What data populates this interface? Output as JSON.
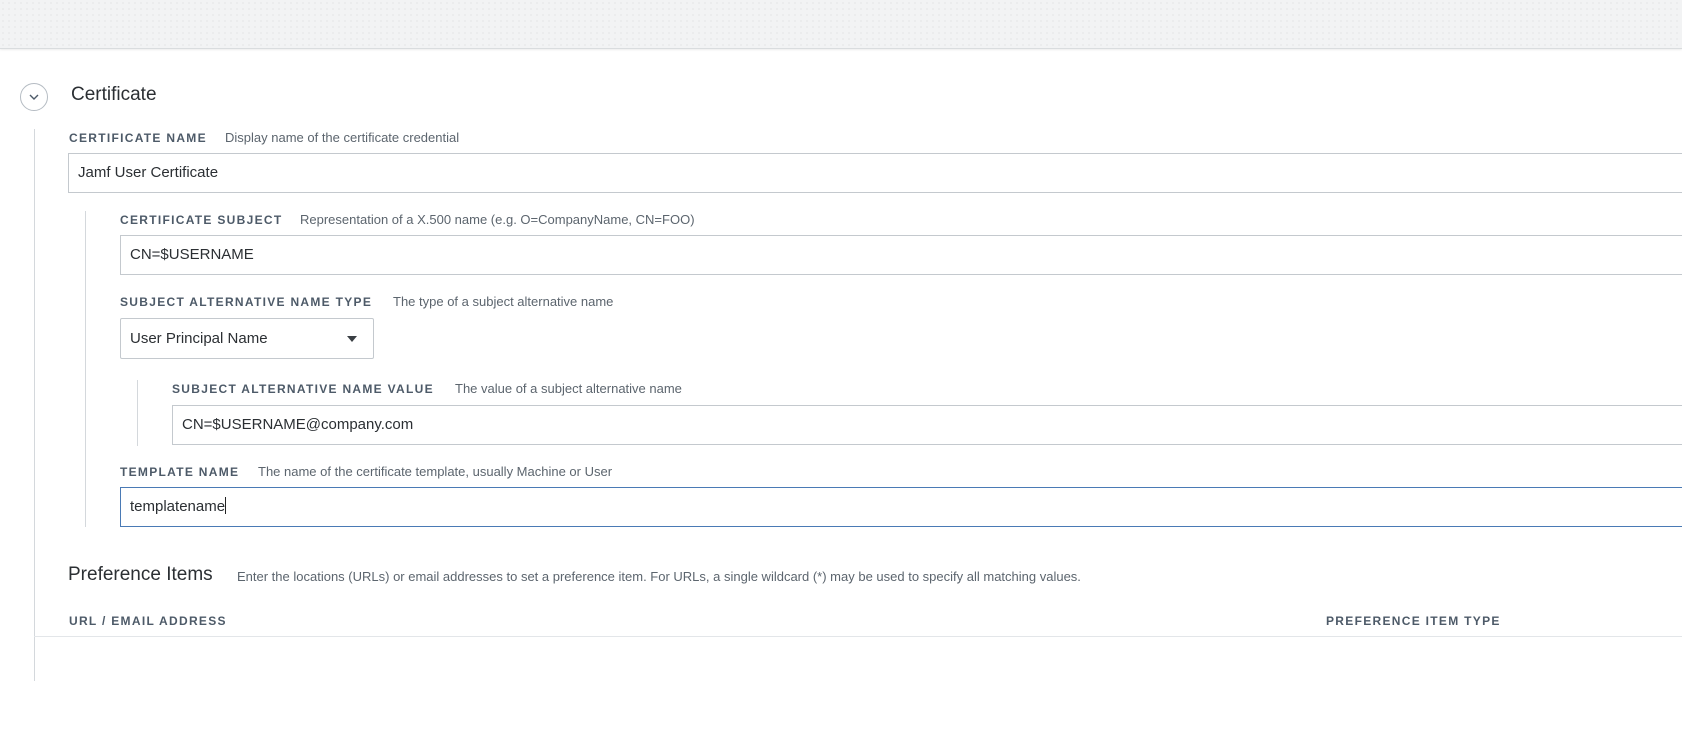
{
  "certificate_section": {
    "title": "Certificate",
    "toggle_icon": "chevron-down-icon",
    "certificate_name": {
      "label": "CERTIFICATE NAME",
      "help": "Display name of the certificate credential",
      "value": "Jamf User Certificate"
    },
    "certificate_subject": {
      "label": "CERTIFICATE SUBJECT",
      "help": "Representation of a X.500 name (e.g. O=CompanyName, CN=FOO)",
      "value": "CN=$USERNAME"
    },
    "san_type": {
      "label": "SUBJECT ALTERNATIVE NAME TYPE",
      "help": "The type of a subject alternative name",
      "selected": "User Principal Name"
    },
    "san_value": {
      "label": "SUBJECT ALTERNATIVE NAME VALUE",
      "help": "The value of a subject alternative name",
      "value": "CN=$USERNAME@company.com"
    },
    "template_name": {
      "label": "TEMPLATE NAME",
      "help": "The name of the certificate template, usually Machine or User",
      "value": "templatename"
    }
  },
  "preference_items": {
    "title": "Preference Items",
    "help": "Enter the locations (URLs) or email addresses to set a preference item. For URLs, a single wildcard (*) may be used to specify all matching values.",
    "columns": [
      "URL / EMAIL ADDRESS",
      "PREFERENCE ITEM TYPE"
    ]
  },
  "colors": {
    "label": "#4d5a68",
    "focus_border": "#4a7ab5",
    "input_border": "#c4c9ce"
  }
}
